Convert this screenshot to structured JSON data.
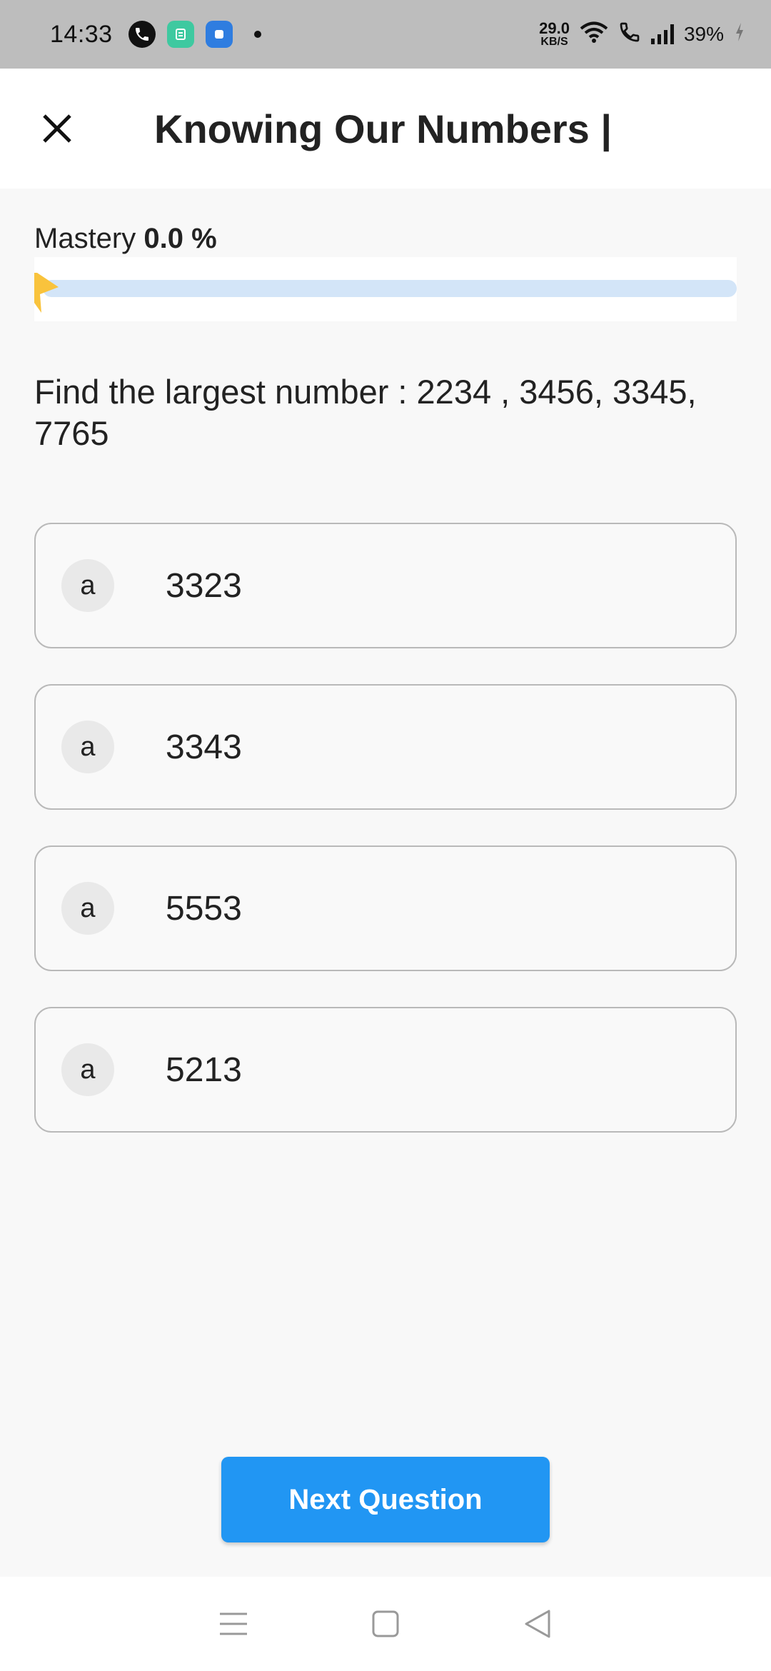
{
  "status_bar": {
    "time": "14:33",
    "net_speed_value": "29.0",
    "net_speed_unit": "KB/S",
    "battery": "39%"
  },
  "header": {
    "title": "Knowing Our Numbers |",
    "close_icon": "close-icon"
  },
  "mastery": {
    "label": "Mastery",
    "value": "0.0 %",
    "progress_fraction": 0.0,
    "track_color": "#d3e5f8",
    "star_color": "#f9c33c"
  },
  "question": {
    "text": "Find the largest number : 2234 , 3456, 3345, 7765"
  },
  "options": [
    {
      "badge": "a",
      "text": "3323"
    },
    {
      "badge": "a",
      "text": "3343"
    },
    {
      "badge": "a",
      "text": "5553"
    },
    {
      "badge": "a",
      "text": "5213"
    }
  ],
  "actions": {
    "next_label": "Next Question",
    "accent": "#2196f3"
  },
  "nav_bar": {
    "icons": [
      "menu-icon",
      "home-square-icon",
      "back-triangle-icon"
    ]
  }
}
